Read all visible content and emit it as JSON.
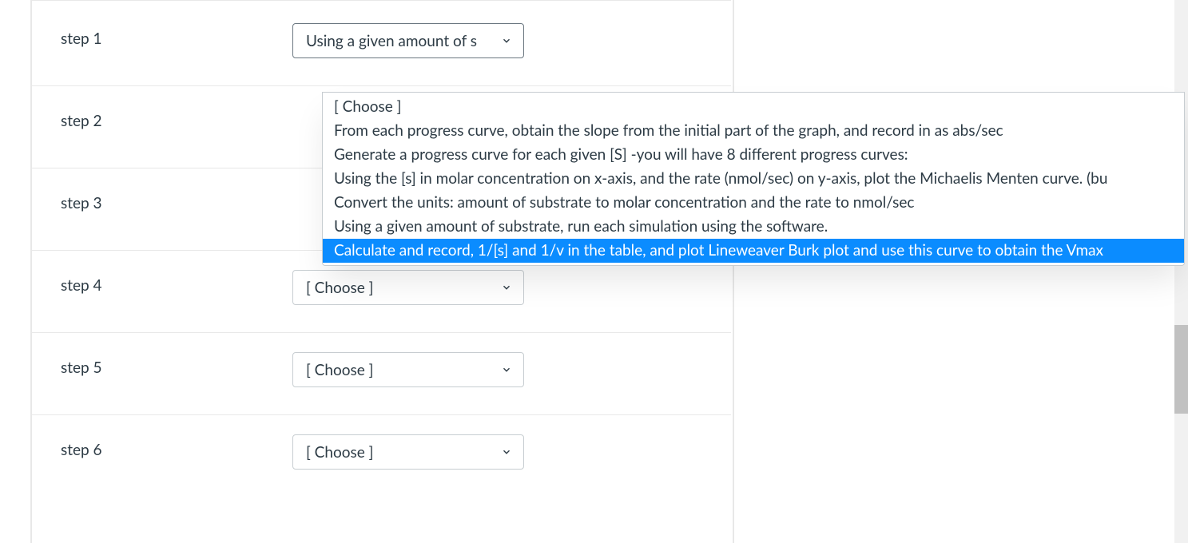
{
  "placeholder": "[ Choose ]",
  "steps": [
    {
      "label": "step 1",
      "selected": "Using a given amount of s",
      "open": true
    },
    {
      "label": "step 2",
      "selected": "",
      "open": false
    },
    {
      "label": "step 3",
      "selected": "",
      "open": false,
      "ghost": true
    },
    {
      "label": "step 4",
      "selected": "[ Choose ]",
      "open": false
    },
    {
      "label": "step 5",
      "selected": "[ Choose ]",
      "open": false
    },
    {
      "label": "step 6",
      "selected": "[ Choose ]",
      "open": false
    }
  ],
  "dropdown": {
    "options": [
      "[ Choose ]",
      "From each progress curve, obtain the slope from the initial part of the graph, and record in as abs/sec",
      "Generate a progress curve for each given [S] -you will have 8 different progress curves:",
      "Using the [s] in molar concentration on x-axis, and the rate (nmol/sec) on y-axis, plot the Michaelis Menten curve. (bu",
      "Convert the units: amount of substrate to molar concentration and the rate to nmol/sec",
      "Using a given amount of substrate, run each simulation using the software.",
      "Calculate and record, 1/[s] and 1/v in the table, and plot Lineweaver Burk plot and use this curve to obtain the Vmax"
    ],
    "highlight_index": 6
  }
}
